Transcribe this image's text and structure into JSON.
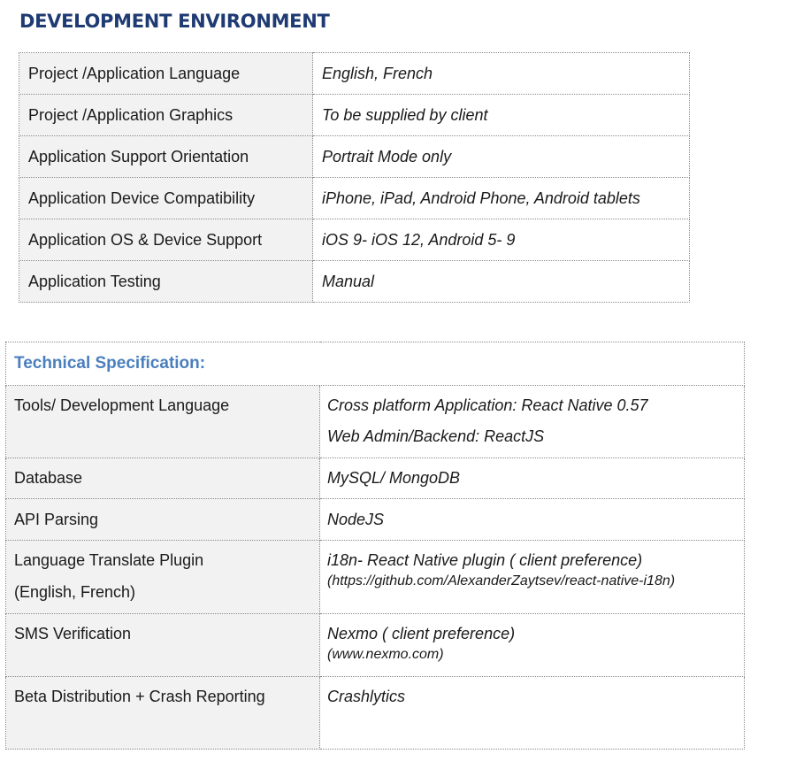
{
  "dev_environment": {
    "title": "DEVELOPMENT ENVIRONMENT",
    "rows": [
      {
        "label": "Project /Application Language",
        "value": "English, French"
      },
      {
        "label": "Project /Application Graphics",
        "value": "To be supplied by client"
      },
      {
        "label": "Application Support Orientation",
        "value": "Portrait Mode only"
      },
      {
        "label": "Application Device Compatibility",
        "value": "iPhone, iPad, Android Phone, Android tablets"
      },
      {
        "label": "Application OS & Device Support",
        "value": "iOS 9- iOS 12, Android 5- 9"
      },
      {
        "label": "Application Testing",
        "value": "Manual"
      }
    ]
  },
  "tech_spec": {
    "title": "Technical Specification:",
    "rows": [
      {
        "label": "Tools/ Development Language",
        "value_lines": [
          "Cross platform Application: React Native 0.57",
          "Web Admin/Backend: ReactJS"
        ]
      },
      {
        "label": "Database",
        "value_lines": [
          "MySQL/ MongoDB"
        ]
      },
      {
        "label": "API Parsing",
        "value_lines": [
          "NodeJS"
        ]
      },
      {
        "label_lines": [
          "Language Translate Plugin",
          "(English, French)"
        ],
        "value_lines": [
          "i18n- React Native plugin ( client preference)",
          "(https://github.com/AlexanderZaytsev/react-native-i18n)"
        ]
      },
      {
        "label": "SMS Verification",
        "value_lines": [
          "Nexmo ( client preference)",
          "(www.nexmo.com)"
        ]
      },
      {
        "label": "Beta Distribution + Crash Reporting",
        "value_lines": [
          "Crashlytics"
        ]
      }
    ]
  }
}
